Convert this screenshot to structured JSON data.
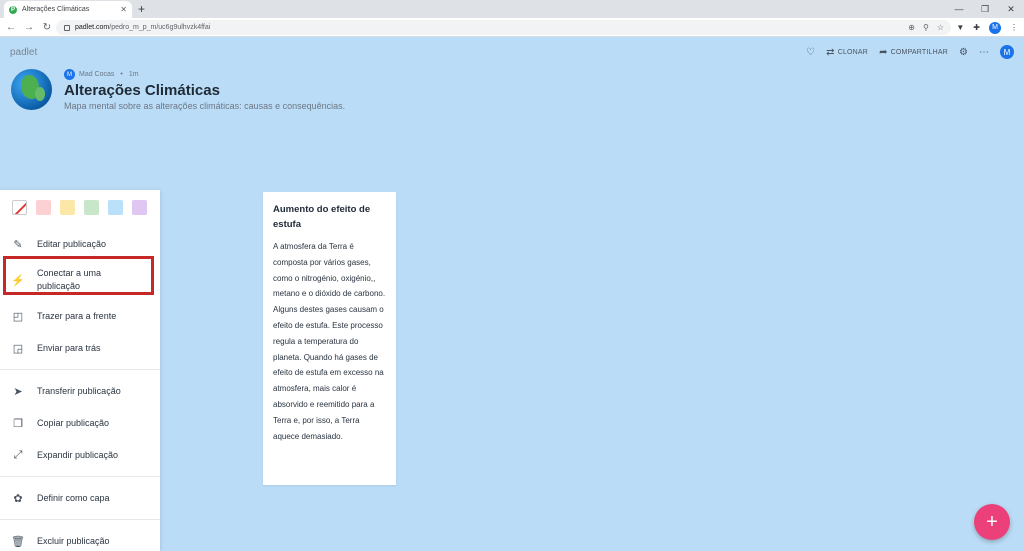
{
  "browser": {
    "tab_title": "Alterações Climáticas",
    "new_tab": "+",
    "url_host": "padlet.com",
    "url_path": "/pedro_m_p_m/uc6g9ulhvzk4ffai",
    "profile_initial": "M"
  },
  "header": {
    "logo": "padlet",
    "clone_label": "CLONAR",
    "share_label": "COMPARTILHAR",
    "avatar_initial": "M"
  },
  "board": {
    "author_initial": "M",
    "author": "Mad Cocas",
    "time": "1m",
    "title": "Alterações Climáticas",
    "subtitle": "Mapa mental sobre as alterações climáticas: causas e consequências."
  },
  "menu": {
    "swatches": [
      "none",
      "#fcd1d4",
      "#fbe7a8",
      "#c8e6c9",
      "#b9e1f9",
      "#dfc7f2"
    ],
    "items": [
      {
        "label": "Editar publicação",
        "icon": "pencil-icon"
      },
      {
        "label": "Conectar a uma publicação",
        "icon": "plug-icon"
      },
      {
        "label": "Trazer para a frente",
        "icon": "bring-front-icon"
      },
      {
        "label": "Enviar para trás",
        "icon": "send-back-icon"
      },
      {
        "label": "Transferir publicação",
        "icon": "send-icon"
      },
      {
        "label": "Copiar publicação",
        "icon": "copy-icon"
      },
      {
        "label": "Expandir publicação",
        "icon": "expand-icon"
      },
      {
        "label": "Definir como capa",
        "icon": "cover-icon"
      },
      {
        "label": "Excluir publicação",
        "icon": "trash-icon"
      }
    ]
  },
  "post": {
    "title": "Aumento do efeito de estufa",
    "body": "A atmosfera da Terra é composta por vários gases, como o nitrogénio, oxigénio,, metano e o dióxido de carbono. Alguns destes gases causam o efeito de estufa. Este processo regula a temperatura do planeta. Quando há gases de efeito de estufa em excesso na atmosfera, mais calor é absorvido e reemitido para a Terra e, por isso, a Terra aquece demasiado."
  },
  "fab_label": "+"
}
